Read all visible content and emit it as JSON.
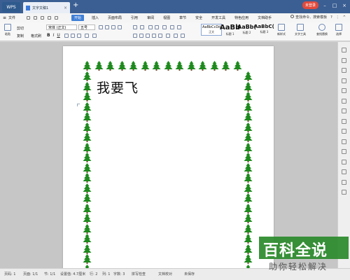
{
  "titlebar": {
    "app_tab": "WPS",
    "doc_tab": "文字文稿1",
    "close_glyph": "×",
    "new_tab_glyph": "+",
    "login_label": "未登录",
    "min_glyph": "–",
    "max_glyph": "□",
    "close_window_glyph": "×"
  },
  "menubar": {
    "file_label": "文件",
    "menu_glyph": "≡",
    "tabs": [
      "开始",
      "插入",
      "页面布局",
      "引用",
      "审阅",
      "视图",
      "章节",
      "安全",
      "开发工具",
      "特色应用",
      "文档助手"
    ],
    "active_tab": "开始",
    "search_label": "查找命令、搜索模板",
    "help_glyph": "?",
    "more_glyph": "⋮",
    "collapse_glyph": "^"
  },
  "ribbon": {
    "paste_label": "粘贴",
    "cut_label": "剪切",
    "copy_label": "复制",
    "format_painter_label": "格式刷",
    "font_name": "宋体 (正文)",
    "font_size": "五号",
    "bold": "B",
    "italic": "I",
    "underline": "U",
    "styles": [
      {
        "preview": "AaBbCcDd",
        "label": "正文"
      },
      {
        "preview": "AaBb",
        "label": "标题 1"
      },
      {
        "preview": "AaBb(",
        "label": "标题 2"
      },
      {
        "preview": "AaBbC(",
        "label": "标题 3"
      }
    ],
    "new_style_label": "新样式",
    "text_tools_label": "文字工具",
    "find_replace_label": "查找替换",
    "select_label": "选择"
  },
  "document": {
    "heading": "我要飞"
  },
  "statusbar": {
    "page_num": "页码: 1",
    "page": "页面: 1/1",
    "section": "节: 1/1",
    "position": "设置值: 4.7厘米",
    "row": "行: 2",
    "column": "列: 1",
    "word_count": "字数: 3",
    "spell_check": "拼写检查",
    "doc_check": "文档校对",
    "unsaved": "未保存"
  },
  "watermark": {
    "title": "百科全说",
    "subtitle": "助你轻松解决"
  },
  "colors": {
    "titlebar": "#3b5f93",
    "accent": "#3f7fd6",
    "tree_green": "#1e8a1e",
    "watermark_green": "#2a8a2a"
  }
}
